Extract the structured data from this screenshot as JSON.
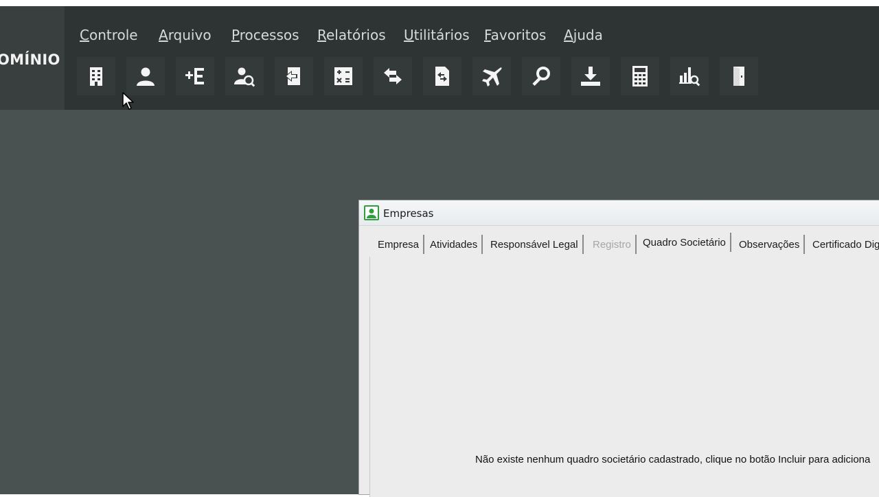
{
  "app": {
    "logo_text": "OMÍNIO"
  },
  "menu": [
    {
      "pre": "",
      "acc": "C",
      "post": "ontrole"
    },
    {
      "pre": "",
      "acc": "A",
      "post": "rquivo"
    },
    {
      "pre": "",
      "acc": "P",
      "post": "rocessos"
    },
    {
      "pre": "",
      "acc": "R",
      "post": "elatórios"
    },
    {
      "pre": "",
      "acc": "U",
      "post": "tilitários"
    },
    {
      "pre": "",
      "acc": "F",
      "post": "avoritos"
    },
    {
      "pre": "",
      "acc": "A",
      "post": "juda"
    }
  ],
  "toolbar_icons": [
    "building-icon",
    "user-icon",
    "add-list-icon",
    "user-search-icon",
    "export-icon",
    "calculator-sheet-icon",
    "transfer-icon",
    "document-swap-icon",
    "airplane-icon",
    "search-icon",
    "download-icon",
    "calculator-icon",
    "chart-search-icon",
    "door-exit-icon"
  ],
  "window": {
    "title": "Empresas",
    "tabs": [
      {
        "label": "Empresa",
        "state": "normal"
      },
      {
        "label": "Atividades",
        "state": "normal"
      },
      {
        "label": "Responsável Legal",
        "state": "normal"
      },
      {
        "label": "Registro",
        "state": "disabled"
      },
      {
        "label": "Quadro Societário",
        "state": "active"
      },
      {
        "label": "Observações",
        "state": "normal"
      },
      {
        "label": "Certificado Dig",
        "state": "normal"
      }
    ],
    "empty_message": "Não existe nenhum quadro societário cadastrado, clique no botão Incluir para adiciona"
  },
  "colors": {
    "appbar": "#2e3333",
    "desktop": "#4a5251",
    "window_bg": "#ececec",
    "window_icon": "#2f9e3c"
  }
}
